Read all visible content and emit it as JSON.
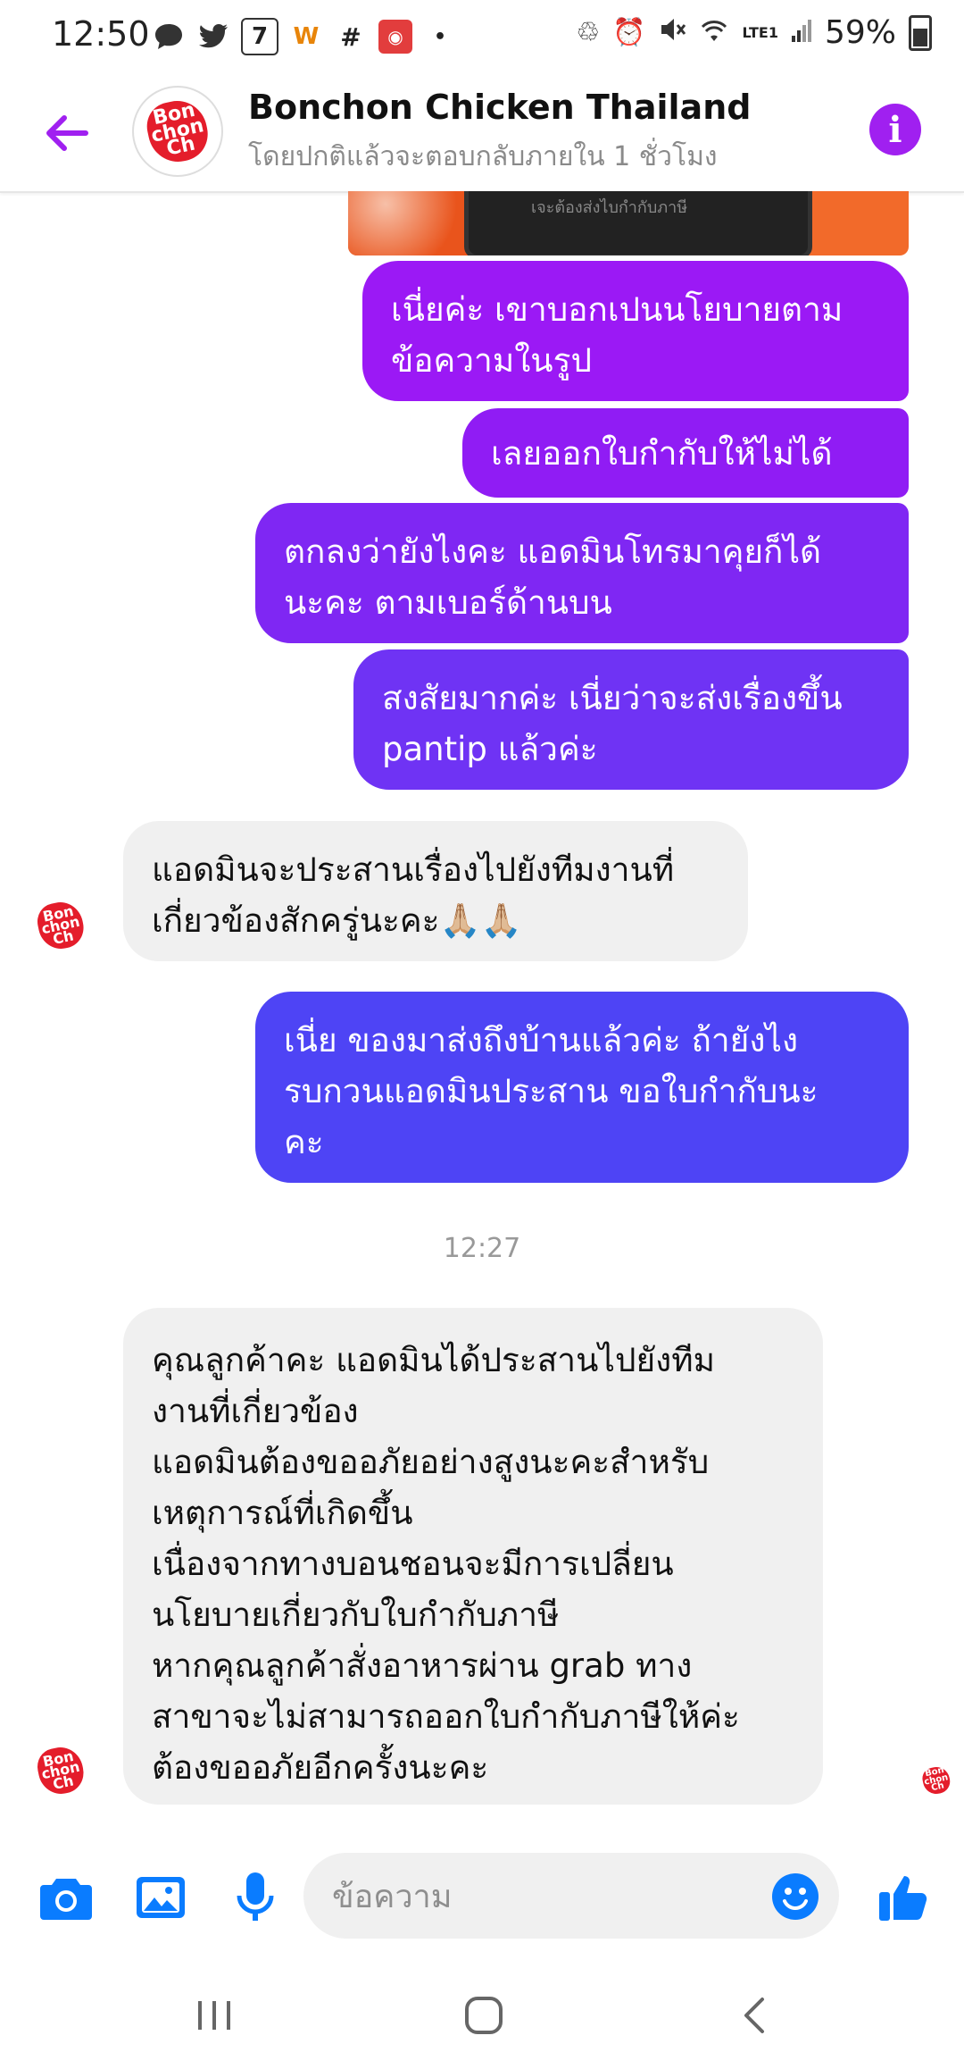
{
  "status_bar": {
    "time": "12:50",
    "battery": "59%",
    "network": "LTE1",
    "notification_icons": [
      "chat-bubble-icon",
      "twitter-icon",
      "seven-eleven-icon",
      "wongnai-icon",
      "grid-icon",
      "line-man-icon"
    ]
  },
  "header": {
    "title": "Bonchon Chicken Thailand",
    "subtitle": "โดยปกติแล้วจะตอบกลับภายใน 1 ชั่วโมง",
    "avatar_text": "Bon\nchon\nCh",
    "photo_text": "เจะต้องส่งไบกำกับภาษี"
  },
  "messages": {
    "m1": "เนี่ยค่ะ เขาบอกเปนนโยบายตาม\nข้อความในรูป",
    "m2": "เลยออกใบกำกับให้ไม่ได้",
    "m3": "ตกลงว่ายังไงคะ แอดมินโทรมาคุยก็ได้\nนะคะ ตามเบอร์ด้านบน",
    "m4": "สงสัยมากค่ะ เนี่ยว่าจะส่งเรื่องขึ้น\npantip แล้วค่ะ",
    "m5": "แอดมินจะประสานเรื่องไปยังทีมงานที่\nเกี่ยวข้องสักครู่นะคะ🙏🏼🙏🏼",
    "m6": "เนี่ย ของมาส่งถึงบ้านแล้วค่ะ ถ้ายังไง\nรบกวนแอดมินประสาน ขอใบกำกับนะ\nคะ",
    "timestamp": "12:27",
    "m7": "คุณลูกค้าคะ แอดมินได้ประสานไปยังทีม\nงานที่เกี่ยวข้อง\nแอดมินต้องขออภัยอย่างสูงนะคะสำหรับ\nเหตุการณ์ที่เกิดขึ้น\nเนื่องจากทางบอนชอนจะมีการเปลี่ยน\nนโยบายเกี่ยวกับใบกำกับภาษี\nหากคุณลูกค้าสั่งอาหารผ่าน grab ทาง\nสาขาจะไม่สามารถออกใบกำกับภาษีให้ค่ะ\nต้องขออภัยอีกครั้งนะคะ"
  },
  "composer": {
    "placeholder": "ข้อความ",
    "value": ""
  },
  "colors": {
    "accent": "#a020f0",
    "bubble_violet": "#9b19f5",
    "bubble_purple": "#7d2ef3",
    "bubble_indigo": "#4e44f5",
    "incoming_bg": "#f0f0f0",
    "icon_blue": "#0a7cff",
    "brand_red": "#e41d2b"
  }
}
